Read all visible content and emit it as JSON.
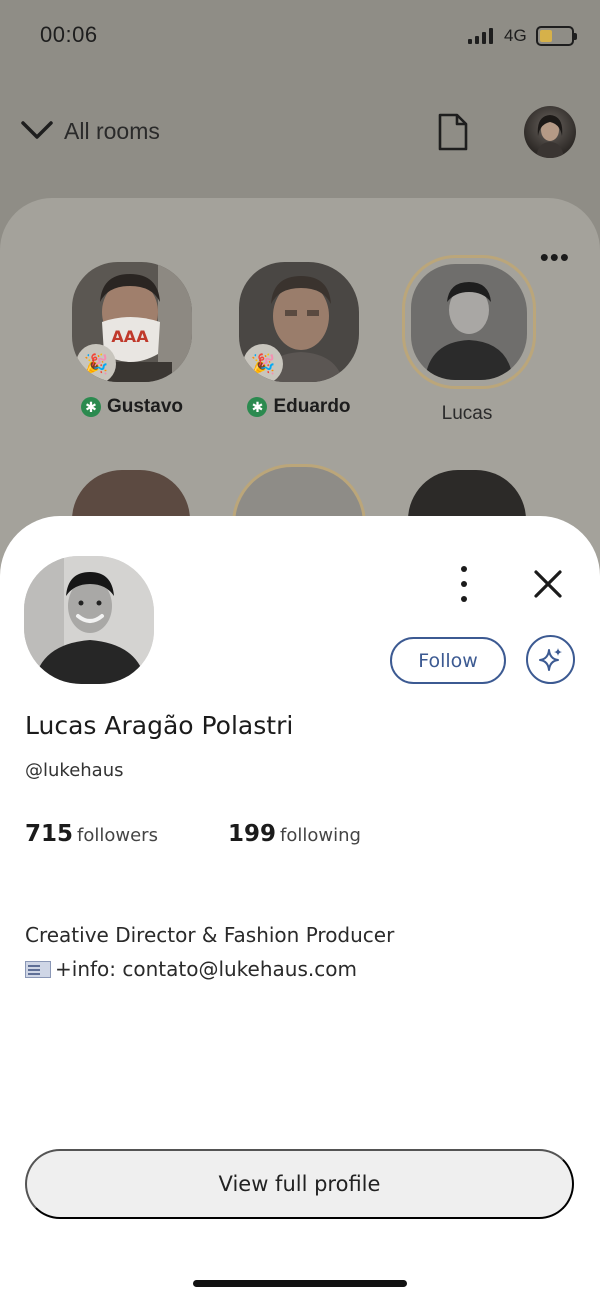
{
  "status_bar": {
    "time": "00:06",
    "network": "4G",
    "battery_level": 0.4
  },
  "top_nav": {
    "rooms_label": "All rooms"
  },
  "room": {
    "speakers": [
      {
        "name": "Gustavo"
      },
      {
        "name": "Eduardo"
      },
      {
        "name": "Lucas"
      }
    ]
  },
  "profile": {
    "full_name": "Lucas Aragão Polastri",
    "username": "@lukehaus",
    "follow_label": "Follow",
    "followers_count": "715",
    "followers_label": "followers",
    "following_count": "199",
    "following_label": "following",
    "bio_line1": "Creative Director & Fashion Producer",
    "bio_line2": "+info: contato@lukehaus.com",
    "view_full_label": "View full profile"
  },
  "colors": {
    "accent": "#3c5a92",
    "badge_green": "#2b8a4f"
  }
}
